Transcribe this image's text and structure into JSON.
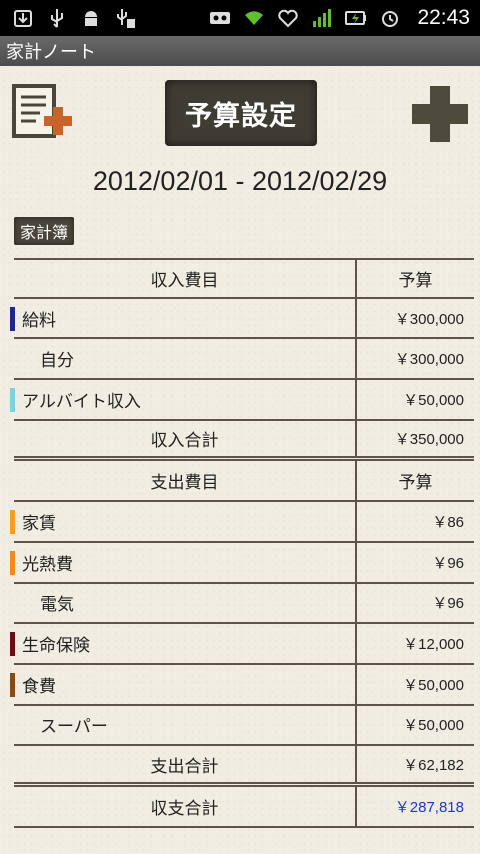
{
  "status_bar": {
    "time": "22:43",
    "icons_left": [
      "download-icon",
      "usb-icon",
      "android-debug-icon",
      "usb-p-icon"
    ],
    "icons_right": [
      "voicemail-icon",
      "wifi-icon",
      "heart-icon",
      "signal-icon",
      "battery-icon",
      "alarm-icon"
    ]
  },
  "app": {
    "title": "家計ノート"
  },
  "toolbar": {
    "title": "予算設定"
  },
  "period": "2012/02/01 - 2012/02/29",
  "section_label": "家計簿",
  "income": {
    "header_name": "収入費目",
    "header_value": "予算",
    "rows": [
      {
        "name": "給料",
        "value": "￥300,000",
        "color": "#1a2a8c",
        "indent": false
      },
      {
        "name": "自分",
        "value": "￥300,000",
        "color": "",
        "indent": true
      },
      {
        "name": "アルバイト収入",
        "value": "￥50,000",
        "color": "#7fd0e3",
        "indent": false
      }
    ],
    "total_label": "収入合計",
    "total_value": "￥350,000"
  },
  "expense": {
    "header_name": "支出費目",
    "header_value": "予算",
    "rows": [
      {
        "name": "家賃",
        "value": "￥86",
        "color": "#f0a020",
        "indent": false
      },
      {
        "name": "光熱費",
        "value": "￥96",
        "color": "#f08a20",
        "indent": false
      },
      {
        "name": "電気",
        "value": "￥96",
        "color": "",
        "indent": true
      },
      {
        "name": "生命保険",
        "value": "￥12,000",
        "color": "#6a1010",
        "indent": false
      },
      {
        "name": "食費",
        "value": "￥50,000",
        "color": "#8a4a10",
        "indent": false
      },
      {
        "name": "スーパー",
        "value": "￥50,000",
        "color": "",
        "indent": true
      }
    ],
    "total_label": "支出合計",
    "total_value": "￥62,182"
  },
  "balance": {
    "label": "収支合計",
    "value": "￥287,818",
    "value_color": "#1a37d6"
  }
}
